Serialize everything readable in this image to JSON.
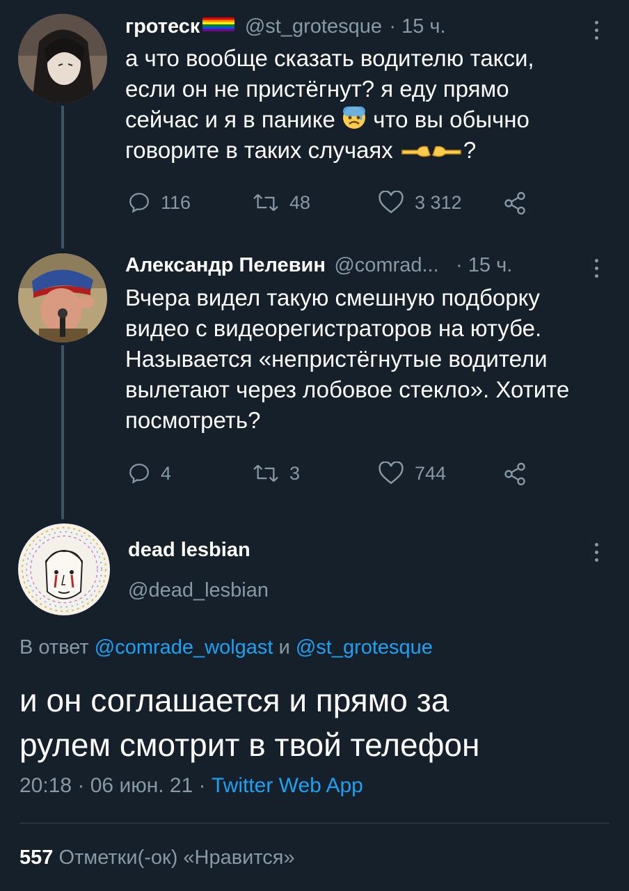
{
  "tweet1": {
    "name": "гротеск",
    "handle": "@st_grotesque",
    "time": "· 15 ч.",
    "text_line1": "а что вообще сказать водителю такси,",
    "text_line2": "если он не пристёгнут? я еду прямо",
    "text_line3a": "сейчас и я в панике",
    "text_line3b": "что вы обычно",
    "text_line4a": "говорите в таких случаях",
    "text_line4b": "?",
    "replies": "116",
    "retweets": "48",
    "likes": "3 312"
  },
  "tweet2": {
    "name": "Александр Пелевин",
    "handle": "@comrad...",
    "time": "· 15 ч.",
    "text_line1": "Вчера видел такую смешную подборку",
    "text_line2": "видео с видеорегистраторов на ютубе.",
    "text_line3": "Называется «непристёгнутые водители",
    "text_line4": "вылетают через лобовое стекло». Хотите",
    "text_line5": "посмотреть?",
    "replies": "4",
    "retweets": "3",
    "likes": "744"
  },
  "main_tweet": {
    "name": "dead lesbian",
    "handle": "@dead_lesbian",
    "reply_prefix": "В ответ",
    "reply_user1": "@comrade_wolgast",
    "reply_and": "и",
    "reply_user2": "@st_grotesque",
    "text_line1": "и он соглашается и прямо за",
    "text_line2": "рулем смотрит в твой телефон",
    "timestamp": "20:18 · 06 июн. 21 ·",
    "source": "Twitter Web App",
    "likes_count": "557",
    "likes_label": "Отметки(-ок) «Нравится»"
  },
  "colors": {
    "background": "#15202b",
    "muted": "#8899a6",
    "link": "#1da1f2",
    "thread_line": "#3d5466"
  }
}
